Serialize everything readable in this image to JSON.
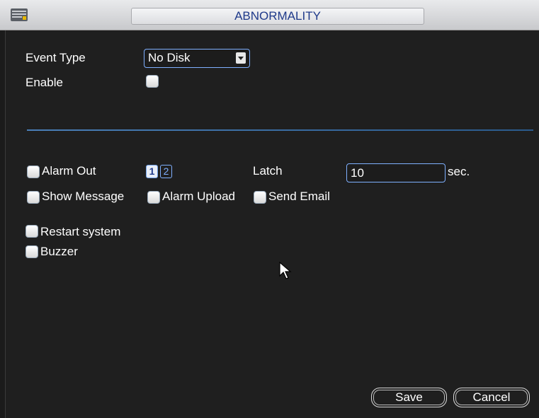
{
  "window": {
    "title": "ABNORMALITY",
    "icon": "window-menu-icon"
  },
  "form": {
    "event_type_label": "Event Type",
    "event_type_value": "No Disk",
    "enable_label": "Enable",
    "enable_checked": false
  },
  "actions": {
    "alarm_out_label": "Alarm Out",
    "alarm_out_channels": [
      "1",
      "2"
    ],
    "latch_label": "Latch",
    "latch_value": "10",
    "latch_unit": "sec.",
    "show_message_label": "Show Message",
    "alarm_upload_label": "Alarm Upload",
    "send_email_label": "Send Email",
    "restart_system_label": "Restart system",
    "buzzer_label": "Buzzer"
  },
  "buttons": {
    "save": "Save",
    "cancel": "Cancel"
  },
  "colors": {
    "accent": "#7fb0ff",
    "title_text": "#1f3a8a",
    "background": "#1f1f1f"
  }
}
